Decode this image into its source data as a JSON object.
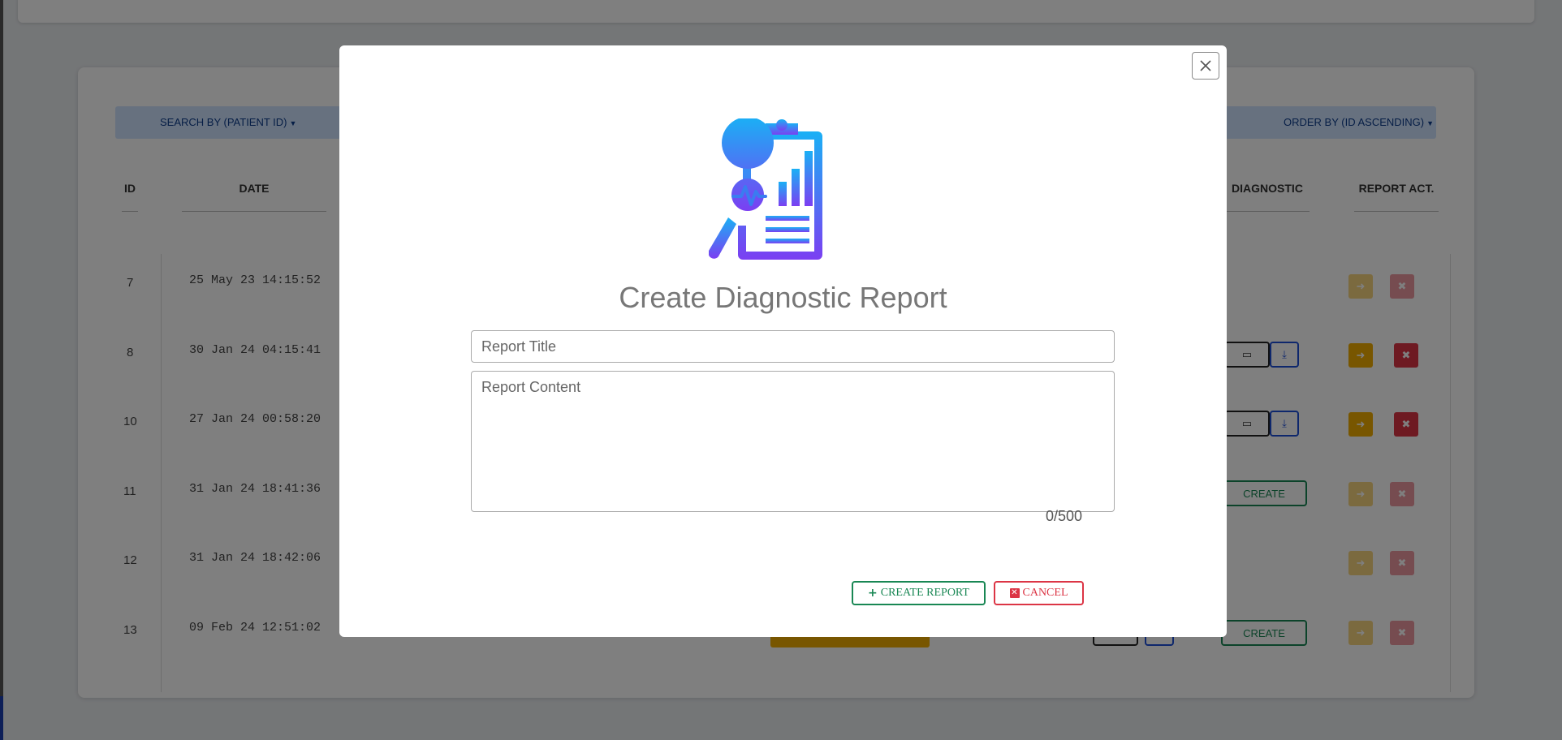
{
  "background": {
    "filters": {
      "search_by": "SEARCH BY (PATIENT ID)",
      "order_by": "ORDER BY (ID ASCENDING)"
    },
    "table": {
      "headers": {
        "id": "ID",
        "date": "DATE",
        "diagnostic": "DIAGNOSTIC",
        "report_act": "REPORT ACT."
      },
      "rows": [
        {
          "id": "7",
          "date": "25 May 23 14:15:52"
        },
        {
          "id": "8",
          "date": "30 Jan 24 04:15:41"
        },
        {
          "id": "10",
          "date": "27 Jan 24 00:58:20"
        },
        {
          "id": "11",
          "date": "31 Jan 24 18:41:36"
        },
        {
          "id": "12",
          "date": "31 Jan 24 18:42:06"
        },
        {
          "id": "13",
          "date": "09 Feb 24 12:51:02"
        }
      ],
      "create_label": "CREATE"
    }
  },
  "modal": {
    "title": "Create Diagnostic Report",
    "title_placeholder": "Report Title",
    "title_value": "",
    "content_placeholder": "Report Content",
    "content_value": "",
    "counter": "0/500",
    "create_button": "CREATE REPORT",
    "cancel_button": "CANCEL",
    "illustration_icon": "clipboard-chart-magnifier-icon",
    "colors": {
      "create": "#198754",
      "cancel": "#dc3545",
      "gradient_start": "#1ab0f5",
      "gradient_end": "#7b3ff2"
    }
  }
}
